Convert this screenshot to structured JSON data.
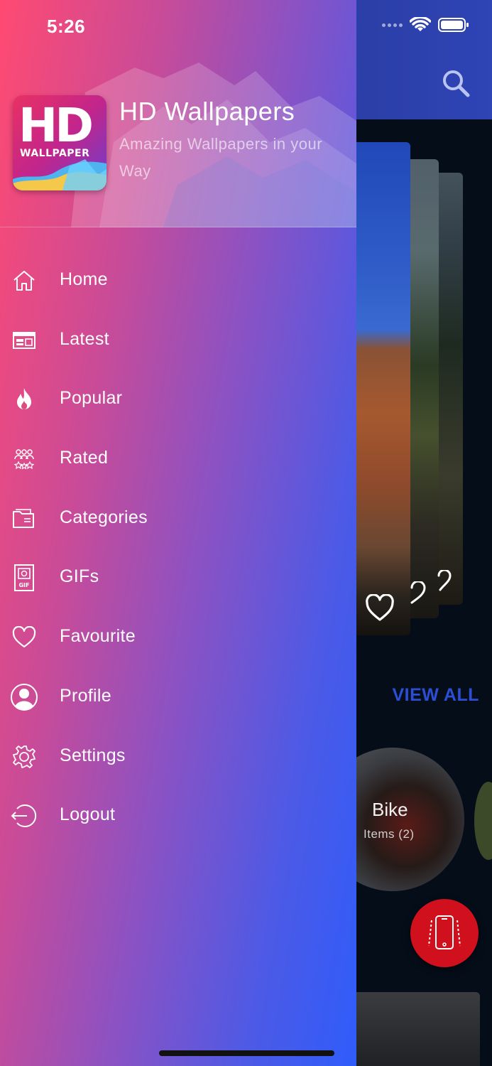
{
  "status_bar": {
    "time": "5:26"
  },
  "background_app": {
    "view_all_label": "VIEW ALL",
    "view_all_label_2": "V",
    "category": {
      "title": "Bike",
      "count": "Items (2)"
    }
  },
  "drawer": {
    "app_name": "HD Wallpapers",
    "tagline": "Amazing Wallpapers in your Way",
    "logo": {
      "main": "HD",
      "sub": "WALLPAPER"
    },
    "menu": [
      {
        "label": "Home",
        "icon": "home-icon"
      },
      {
        "label": "Latest",
        "icon": "calendar-icon"
      },
      {
        "label": "Popular",
        "icon": "fire-icon"
      },
      {
        "label": "Rated",
        "icon": "rated-users-icon"
      },
      {
        "label": "Categories",
        "icon": "folder-icon"
      },
      {
        "label": "GIFs",
        "icon": "gif-icon"
      },
      {
        "label": "Favourite",
        "icon": "heart-icon"
      },
      {
        "label": "Profile",
        "icon": "user-icon"
      },
      {
        "label": "Settings",
        "icon": "gear-icon"
      },
      {
        "label": "Logout",
        "icon": "logout-icon"
      }
    ]
  },
  "colors": {
    "accent": "#2a4fd6",
    "fab": "#d0101c",
    "drawer_start": "#ff4a72",
    "drawer_end": "#2f5cfb"
  }
}
